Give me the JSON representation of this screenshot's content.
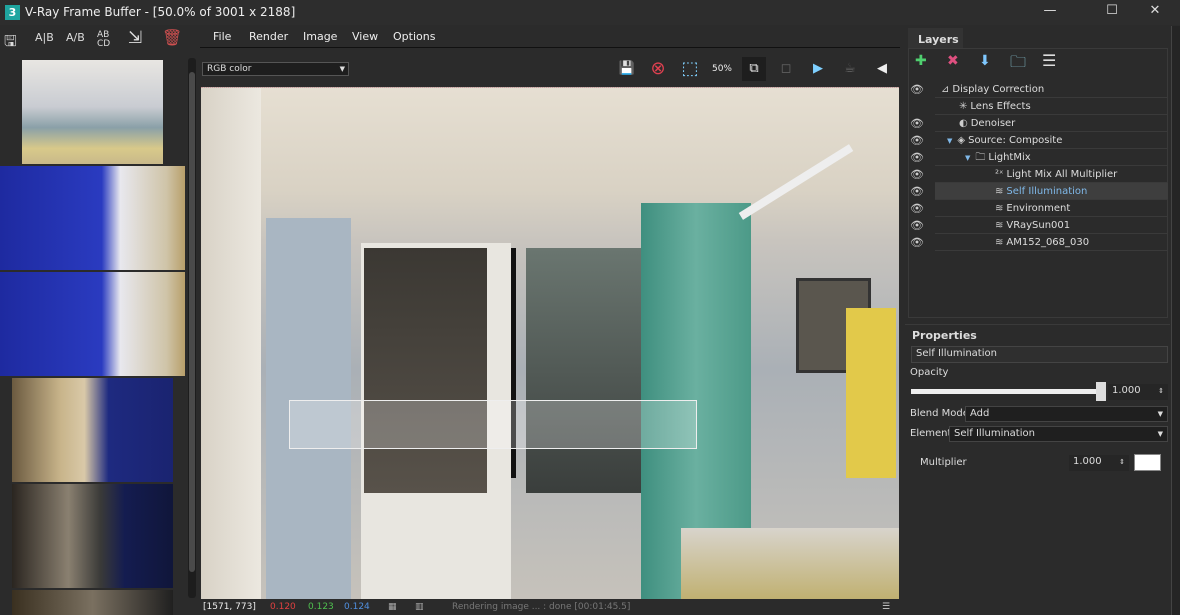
{
  "window": {
    "app_icon": "3",
    "title": "V-Ray Frame Buffer - [50.0% of 3001 x 2188]",
    "minimize": "—",
    "maximize": "☐",
    "close": "✕"
  },
  "history_tools": [
    {
      "icon": "save-history-icon",
      "glyph": "🖫"
    },
    {
      "icon": "ab-vertical-icon",
      "glyph": "A|B"
    },
    {
      "icon": "ab-horizontal-icon",
      "glyph": "A/B"
    },
    {
      "icon": "abcd-icon",
      "glyph": "AB CD"
    },
    {
      "icon": "load-icon",
      "glyph": "⇲"
    },
    {
      "icon": "trash-icon",
      "glyph": "🗑"
    }
  ],
  "menu": [
    "File",
    "Render",
    "Image",
    "View",
    "Options"
  ],
  "channel": {
    "value": "RGB color"
  },
  "toolbar": [
    {
      "icon": "save-icon",
      "glyph": "💾"
    },
    {
      "icon": "stop-icon",
      "glyph": "⊗"
    },
    {
      "icon": "region-select-icon",
      "glyph": "⬚"
    },
    {
      "icon": "zoom-50-icon",
      "glyph": "50%"
    },
    {
      "icon": "teapot-link-icon",
      "glyph": "⧉"
    },
    {
      "icon": "crop-icon",
      "glyph": "◻"
    },
    {
      "icon": "render-icon",
      "glyph": "▶"
    },
    {
      "icon": "interactive-render-icon",
      "glyph": "☕"
    },
    {
      "icon": "render-back-icon",
      "glyph": "◀"
    }
  ],
  "status": {
    "coords": "[1571, 773]",
    "r": "0.120",
    "g": "0.123",
    "b": "0.124",
    "message": "Rendering image ... : done [00:01:45.5]"
  },
  "colors": {
    "r": "#e04040",
    "g": "#4fc04f",
    "b": "#4f8fdf",
    "selected_text": "#7fb8e8"
  },
  "layers": {
    "title": "Layers",
    "tools": [
      {
        "icon": "add-layer-icon",
        "glyph": "✚"
      },
      {
        "icon": "delete-layer-icon",
        "glyph": "✖"
      },
      {
        "icon": "merge-layer-icon",
        "glyph": "⬇"
      },
      {
        "icon": "layer-folder-icon",
        "glyph": "🗀"
      },
      {
        "icon": "layer-presets-icon",
        "glyph": "☰"
      }
    ],
    "items": [
      {
        "label": "Display Correction",
        "icon": "⊿",
        "eye": true,
        "depth": 0
      },
      {
        "label": "Lens Effects",
        "icon": "✳",
        "eye": false,
        "depth": 1
      },
      {
        "label": "Denoiser",
        "icon": "◐",
        "eye": true,
        "depth": 1
      },
      {
        "label": "Source: Composite",
        "icon": "◈",
        "eye": true,
        "depth": 1,
        "expander": "▼"
      },
      {
        "label": "LightMix",
        "icon": "🗀",
        "eye": true,
        "depth": 2,
        "expander": "▼"
      },
      {
        "label": "Light Mix All Multiplier",
        "icon": "²ˣ",
        "eye": true,
        "depth": 3
      },
      {
        "label": "Self Illumination",
        "icon": "≋",
        "eye": true,
        "depth": 3,
        "selected": true
      },
      {
        "label": "Environment",
        "icon": "≋",
        "eye": true,
        "depth": 3
      },
      {
        "label": "VRaySun001",
        "icon": "≋",
        "eye": true,
        "depth": 3
      },
      {
        "label": "AM152_068_030",
        "icon": "≋",
        "eye": true,
        "depth": 3
      }
    ]
  },
  "properties": {
    "title": "Properties",
    "name": "Self Illumination",
    "opacity_label": "Opacity",
    "opacity": "1.000",
    "opacity_fraction": 1.0,
    "blend_label": "Blend Mode",
    "blend": "Add",
    "element_label": "Element",
    "element": "Self Illumination",
    "multiplier_label": "Multiplier",
    "multiplier": "1.000",
    "swatch": "#ffffff"
  }
}
